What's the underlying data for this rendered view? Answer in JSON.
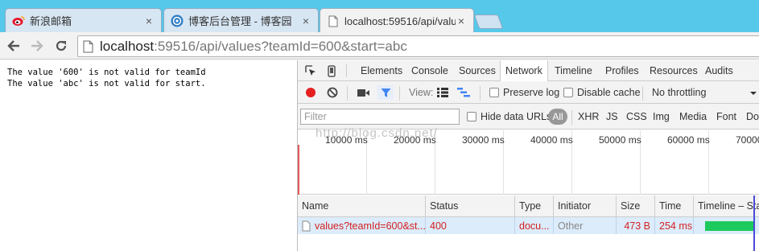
{
  "browser": {
    "tabs": [
      {
        "title": "新浪邮箱",
        "icon": "sina-weibo-icon"
      },
      {
        "title": "博客后台管理 - 博客园",
        "icon": "cnblogs-icon"
      },
      {
        "title": "localhost:59516/api/valu",
        "icon": "page-icon",
        "active": true
      }
    ],
    "address": {
      "host": "localhost",
      "rest": ":59516/api/values?teamId=600&start=abc"
    }
  },
  "page": {
    "lines": [
      "The value '600' is not valid for teamId",
      "The value 'abc' is not valid for start."
    ]
  },
  "devtools": {
    "tabs": [
      "Elements",
      "Console",
      "Sources",
      "Network",
      "Timeline",
      "Profiles",
      "Resources",
      "Audits"
    ],
    "active_tab": "Network",
    "toolbar": {
      "view_label": "View:",
      "preserve_log": "Preserve log",
      "disable_cache": "Disable cache",
      "throttling": "No throttling"
    },
    "filter": {
      "placeholder": "Filter",
      "hide_data_urls": "Hide data URLs",
      "types": [
        "All",
        "XHR",
        "JS",
        "CSS",
        "Img",
        "Media",
        "Font",
        "Do"
      ]
    },
    "overview_ticks": [
      "10000 ms",
      "20000 ms",
      "30000 ms",
      "40000 ms",
      "50000 ms",
      "60000 ms",
      "70000"
    ],
    "watermark": "http://blog.csdn.net/",
    "columns": [
      "Name",
      "Status",
      "Type",
      "Initiator",
      "Size",
      "Time",
      "Timeline – Star"
    ],
    "rows": [
      {
        "name": "values?teamId=600&st...",
        "status": "400",
        "type": "docu...",
        "initiator": "Other",
        "size": "473 B",
        "time": "254 ms"
      }
    ]
  },
  "colors": {
    "tabstrip": "#56c8ea",
    "record": "#e5201f",
    "active_blue": "#4285f4",
    "error_red": "#d32121",
    "waterfall_green": "#1cc95c"
  }
}
